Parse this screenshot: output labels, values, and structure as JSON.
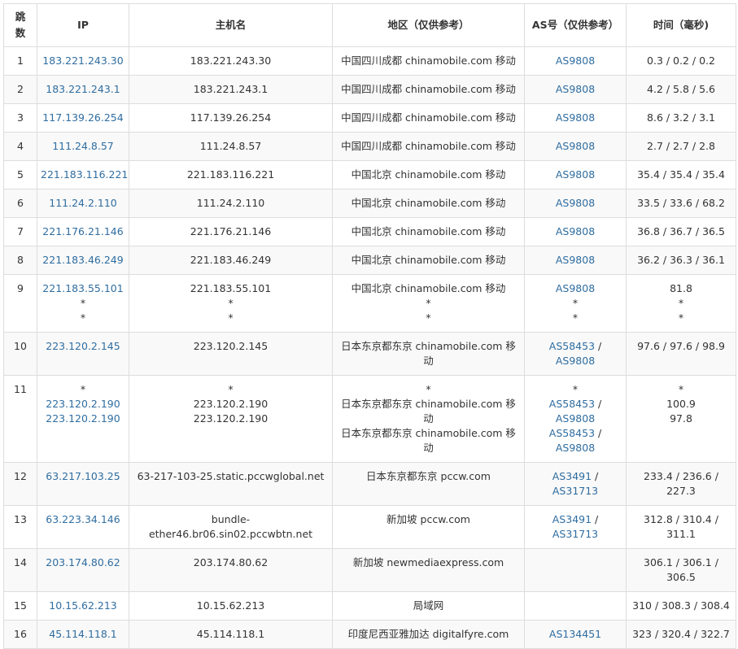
{
  "headers": {
    "hop": "跳数",
    "ip": "IP",
    "host": "主机名",
    "region": "地区（仅供参考）",
    "as": "AS号（仅供参考）",
    "time": "时间（毫秒)"
  },
  "rows": [
    {
      "hop": "1",
      "ip": [
        "183.221.243.30"
      ],
      "host": [
        "183.221.243.30"
      ],
      "region": [
        "中国四川成都 chinamobile.com 移动"
      ],
      "as": [
        [
          "AS9808"
        ]
      ],
      "time": [
        "0.3 / 0.2 / 0.2"
      ]
    },
    {
      "hop": "2",
      "ip": [
        "183.221.243.1"
      ],
      "host": [
        "183.221.243.1"
      ],
      "region": [
        "中国四川成都 chinamobile.com 移动"
      ],
      "as": [
        [
          "AS9808"
        ]
      ],
      "time": [
        "4.2 / 5.8 / 5.6"
      ]
    },
    {
      "hop": "3",
      "ip": [
        "117.139.26.254"
      ],
      "host": [
        "117.139.26.254"
      ],
      "region": [
        "中国四川成都 chinamobile.com 移动"
      ],
      "as": [
        [
          "AS9808"
        ]
      ],
      "time": [
        "8.6 / 3.2 / 3.1"
      ]
    },
    {
      "hop": "4",
      "ip": [
        "111.24.8.57"
      ],
      "host": [
        "111.24.8.57"
      ],
      "region": [
        "中国四川成都 chinamobile.com 移动"
      ],
      "as": [
        [
          "AS9808"
        ]
      ],
      "time": [
        "2.7 / 2.7 / 2.8"
      ]
    },
    {
      "hop": "5",
      "ip": [
        "221.183.116.221"
      ],
      "host": [
        "221.183.116.221"
      ],
      "region": [
        "中国北京 chinamobile.com 移动"
      ],
      "as": [
        [
          "AS9808"
        ]
      ],
      "time": [
        "35.4 / 35.4 / 35.4"
      ]
    },
    {
      "hop": "6",
      "ip": [
        "111.24.2.110"
      ],
      "host": [
        "111.24.2.110"
      ],
      "region": [
        "中国北京 chinamobile.com 移动"
      ],
      "as": [
        [
          "AS9808"
        ]
      ],
      "time": [
        "33.5 / 33.6 / 68.2"
      ]
    },
    {
      "hop": "7",
      "ip": [
        "221.176.21.146"
      ],
      "host": [
        "221.176.21.146"
      ],
      "region": [
        "中国北京 chinamobile.com 移动"
      ],
      "as": [
        [
          "AS9808"
        ]
      ],
      "time": [
        "36.8 / 36.7 / 36.5"
      ]
    },
    {
      "hop": "8",
      "ip": [
        "221.183.46.249"
      ],
      "host": [
        "221.183.46.249"
      ],
      "region": [
        "中国北京 chinamobile.com 移动"
      ],
      "as": [
        [
          "AS9808"
        ]
      ],
      "time": [
        "36.2 / 36.3 / 36.1"
      ]
    },
    {
      "hop": "9",
      "ip": [
        "221.183.55.101",
        "*",
        "*"
      ],
      "host": [
        "221.183.55.101",
        "*",
        "*"
      ],
      "region": [
        "中国北京 chinamobile.com 移动",
        "*",
        "*"
      ],
      "as": [
        [
          "AS9808"
        ],
        [
          "*"
        ],
        [
          "*"
        ]
      ],
      "time": [
        "81.8",
        "*",
        "*"
      ]
    },
    {
      "hop": "10",
      "ip": [
        "223.120.2.145"
      ],
      "host": [
        "223.120.2.145"
      ],
      "region": [
        "日本东京都东京 chinamobile.com 移动"
      ],
      "as": [
        [
          "AS58453",
          "AS9808"
        ]
      ],
      "time": [
        "97.6 / 97.6 / 98.9"
      ]
    },
    {
      "hop": "11",
      "ip": [
        "*",
        "223.120.2.190",
        "223.120.2.190"
      ],
      "host": [
        "*",
        "223.120.2.190",
        "223.120.2.190"
      ],
      "region": [
        "*",
        "日本东京都东京 chinamobile.com 移动",
        "日本东京都东京 chinamobile.com 移动"
      ],
      "as": [
        [
          "*"
        ],
        [
          "AS58453",
          "AS9808"
        ],
        [
          "AS58453",
          "AS9808"
        ]
      ],
      "time": [
        "*",
        "100.9",
        "97.8"
      ]
    },
    {
      "hop": "12",
      "ip": [
        "63.217.103.25"
      ],
      "host": [
        "63-217-103-25.static.pccwglobal.net"
      ],
      "region": [
        "日本东京都东京 pccw.com"
      ],
      "as": [
        [
          "AS3491",
          "AS31713"
        ]
      ],
      "time": [
        "233.4 / 236.6 / 227.3"
      ]
    },
    {
      "hop": "13",
      "ip": [
        "63.223.34.146"
      ],
      "host": [
        "bundle-ether46.br06.sin02.pccwbtn.net"
      ],
      "region": [
        "新加坡 pccw.com"
      ],
      "as": [
        [
          "AS3491",
          "AS31713"
        ]
      ],
      "time": [
        "312.8 / 310.4 / 311.1"
      ]
    },
    {
      "hop": "14",
      "ip": [
        "203.174.80.62"
      ],
      "host": [
        "203.174.80.62"
      ],
      "region": [
        "新加坡 newmediaexpress.com"
      ],
      "as": [],
      "time": [
        "306.1 / 306.1 / 306.5"
      ]
    },
    {
      "hop": "15",
      "ip": [
        "10.15.62.213"
      ],
      "host": [
        "10.15.62.213"
      ],
      "region": [
        "局域网"
      ],
      "as": [],
      "time": [
        "310 / 308.3 / 308.4"
      ]
    },
    {
      "hop": "16",
      "ip": [
        "45.114.118.1"
      ],
      "host": [
        "45.114.118.1"
      ],
      "region": [
        "印度尼西亚雅加达 digitalfyre.com"
      ],
      "as": [
        [
          "AS134451"
        ]
      ],
      "time": [
        "323 / 320.4 / 322.7"
      ]
    }
  ]
}
